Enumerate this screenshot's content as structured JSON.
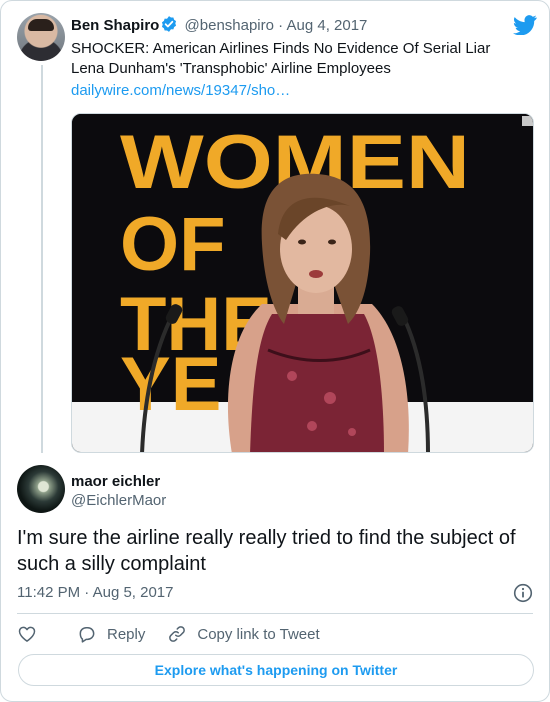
{
  "parent_tweet": {
    "author_name": "Ben Shapiro",
    "handle": "@benshapiro",
    "separator": "·",
    "date": "Aug 4, 2017",
    "text": "SHOCKER: American Airlines Finds No Evidence Of Serial Liar Lena Dunham's 'Transphobic' Airline Employees",
    "link": "dailywire.com/news/19347/sho…",
    "image": {
      "backdrop_lines": [
        "WOMEN",
        "OF",
        "THE",
        "YE"
      ],
      "backdrop_color": "#f0a928"
    }
  },
  "reply_tweet": {
    "author_name": "maor eichler",
    "handle": "@EichlerMaor",
    "text": "I'm sure the airline really really tried to find the subject of such a silly complaint",
    "timestamp": "11:42 PM · Aug 5, 2017"
  },
  "actions": {
    "like_icon": "heart-icon",
    "reply_label": "Reply",
    "copy_link_label": "Copy link to Tweet"
  },
  "explore_button": "Explore what's happening on Twitter",
  "colors": {
    "accent": "#1d9bf0",
    "secondary_text": "#536471",
    "border": "#cfd9de"
  }
}
